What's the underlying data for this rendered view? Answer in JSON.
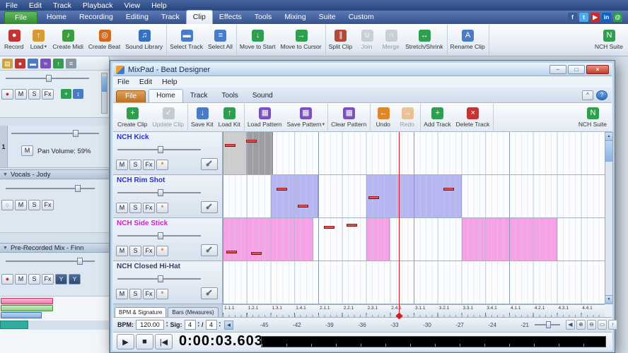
{
  "main": {
    "menubar": [
      "File",
      "Edit",
      "Track",
      "Playback",
      "View",
      "Help"
    ],
    "ribbon": {
      "file_tab": "File",
      "tabs": [
        {
          "label": "Home"
        },
        {
          "label": "Recording"
        },
        {
          "label": "Editing"
        },
        {
          "label": "Track"
        },
        {
          "label": "Clip",
          "active": true
        },
        {
          "label": "Effects"
        },
        {
          "label": "Tools"
        },
        {
          "label": "Mixing"
        },
        {
          "label": "Suite"
        },
        {
          "label": "Custom"
        }
      ],
      "social_icons": [
        {
          "name": "facebook",
          "glyph": "f",
          "color": "#3a5a98"
        },
        {
          "name": "twitter",
          "glyph": "t",
          "color": "#4aabee"
        },
        {
          "name": "youtube",
          "glyph": "▶",
          "color": "#cc2a2a"
        },
        {
          "name": "linkedin",
          "glyph": "in",
          "color": "#0a66c2"
        },
        {
          "name": "share",
          "glyph": "@",
          "color": "#2a9d48"
        }
      ]
    },
    "toolbar": {
      "groups": [
        {
          "buttons": [
            {
              "label": "Record",
              "icon": "●",
              "icon_bg": "#c13535"
            },
            {
              "label": "Load",
              "icon": "↑",
              "icon_bg": "#d79b33",
              "caret": "▾"
            },
            {
              "label": "Create Midi",
              "icon": "♪",
              "icon_bg": "#3f9b3f"
            },
            {
              "label": "Create Beat",
              "icon": "◎",
              "icon_bg": "#d2691e"
            },
            {
              "label": "Sound Library",
              "icon": "♫",
              "icon_bg": "#3a6fc0"
            }
          ]
        },
        {
          "buttons": [
            {
              "label": "Select Track",
              "icon": "▬",
              "icon_bg": "#4a7bc8"
            },
            {
              "label": "Select All",
              "icon": "≡",
              "icon_bg": "#4a7bc8"
            }
          ]
        },
        {
          "buttons": [
            {
              "label": "Move to Start",
              "icon": "↓",
              "icon_bg": "#2f9e4f"
            },
            {
              "label": "Move to Cursor",
              "icon": "→",
              "icon_bg": "#2f9e4f"
            }
          ]
        },
        {
          "buttons": [
            {
              "label": "Split Clip",
              "icon": "∥",
              "icon_bg": "#b5483a"
            },
            {
              "label": "Join",
              "icon": "∪",
              "icon_bg": "#9aa4ae",
              "disabled": true
            },
            {
              "label": "Merge",
              "icon": "∩",
              "icon_bg": "#9aa4ae",
              "disabled": true
            },
            {
              "label": "Stretch/Shrink",
              "icon": "↔",
              "icon_bg": "#2f9e4f"
            }
          ]
        },
        {
          "buttons": [
            {
              "label": "Rename Clip",
              "icon": "A",
              "icon_bg": "#4a7bc8"
            }
          ]
        },
        {
          "buttons": [
            {
              "label": "NCH Suite",
              "icon": "N",
              "icon_bg": "#2f9e4f"
            }
          ]
        }
      ]
    },
    "left_panel": {
      "tools": [
        {
          "name": "open-file",
          "glyph": "▤",
          "color": "#caa43e"
        },
        {
          "name": "record",
          "glyph": "●",
          "color": "#c13535"
        },
        {
          "name": "tracks",
          "glyph": "▬",
          "color": "#4a7bc8"
        },
        {
          "name": "effects",
          "glyph": "≈",
          "color": "#7a4fc0"
        },
        {
          "name": "upload",
          "glyph": "↑",
          "color": "#2f9e4f"
        },
        {
          "name": "menu",
          "glyph": "≡",
          "color": "#8a97a4"
        }
      ],
      "strip_icons": [
        {
          "name": "add-clip",
          "glyph": "+",
          "color": "#2f9e4f"
        },
        {
          "name": "move-vertical",
          "glyph": "↕",
          "color": "#4a7bc8"
        }
      ],
      "icons": {
        "record_dot": "●",
        "empty_dot": "○",
        "split": "Y",
        "collapse": "▼"
      },
      "track_number": "1",
      "pan_volume": "Pan Volume: 59%",
      "btn_m": "M",
      "btn_s": "S",
      "btn_fx": "Fx",
      "section1": "Vocals - Jody",
      "section2": "Pre-Recorded Mix - Finn"
    }
  },
  "dialog": {
    "title": "MixPad - Beat Designer",
    "window_buttons": {
      "minimize": "–",
      "maximize": "□",
      "close": "×"
    },
    "menu": [
      "File",
      "Edit",
      "Help"
    ],
    "ribbon": {
      "file_tab": "File",
      "tabs": [
        {
          "label": "Home",
          "active": true
        },
        {
          "label": "Track"
        },
        {
          "label": "Tools"
        },
        {
          "label": "Sound"
        }
      ],
      "collapse_glyph": "^",
      "help_glyph": "?"
    },
    "toolbar": {
      "groups": [
        {
          "buttons": [
            {
              "label": "Create Clip",
              "icon": "+",
              "icon_bg": "#2f9e4f"
            },
            {
              "label": "Update Clip",
              "icon": "✓",
              "icon_bg": "#8f9aa6",
              "disabled": true
            }
          ]
        },
        {
          "buttons": [
            {
              "label": "Save Kit",
              "icon": "↓",
              "icon_bg": "#4a7bc8"
            },
            {
              "label": "Load Kit",
              "icon": "↑",
              "icon_bg": "#2f9e4f"
            }
          ]
        },
        {
          "buttons": [
            {
              "label": "Load Pattern",
              "icon": "▦",
              "icon_bg": "#7a4fc0"
            },
            {
              "label": "Save Pattern",
              "icon": "▦",
              "icon_bg": "#7a4fc0",
              "caret": "▾"
            }
          ]
        },
        {
          "buttons": [
            {
              "label": "Clear Pattern",
              "icon": "▦",
              "icon_bg": "#7a4fc0"
            }
          ]
        },
        {
          "buttons": [
            {
              "label": "Undo",
              "icon": "←",
              "icon_bg": "#e0862a"
            },
            {
              "label": "Redo",
              "icon": "→",
              "icon_bg": "#e0862a",
              "disabled": true
            }
          ]
        },
        {
          "buttons": [
            {
              "label": "Add Track",
              "icon": "+",
              "icon_bg": "#2f9e4f"
            },
            {
              "label": "Delete Track",
              "icon": "×",
              "icon_bg": "#c13535"
            }
          ]
        },
        {
          "buttons": [
            {
              "label": "NCH Suite",
              "icon": "N",
              "icon_bg": "#2f9e4f"
            }
          ]
        }
      ]
    },
    "track_btns": {
      "m": "M",
      "s": "S",
      "fx": "Fx",
      "burst": "*"
    },
    "grid": {
      "beats_total": 16,
      "playhead_beat": 7.37,
      "tracks": [
        {
          "name": "NCH Kick",
          "name_color": "#2233cc",
          "cells": [
            {
              "start": 0,
              "len": 1,
              "color": "#cdcdcd"
            },
            {
              "start": 1,
              "len": 1.1,
              "color": "#9d9da2"
            }
          ],
          "markers": [
            {
              "beat": 0.15,
              "y": 28
            },
            {
              "beat": 1.05,
              "y": 18
            }
          ]
        },
        {
          "name": "NCH Rim Shot",
          "name_color": "#2233cc",
          "cells": [
            {
              "start": 2,
              "len": 2,
              "color": "#b6b6f2"
            },
            {
              "start": 6,
              "len": 4,
              "color": "#b6b6f2"
            }
          ],
          "markers": [
            {
              "beat": 2.3,
              "y": 30
            },
            {
              "beat": 3.2,
              "y": 70
            },
            {
              "beat": 6.15,
              "y": 50
            },
            {
              "beat": 9.3,
              "y": 30
            }
          ]
        },
        {
          "name": "NCH Side Stick",
          "name_color": "#cc22cc",
          "cells": [
            {
              "start": 0,
              "len": 3.8,
              "color": "#f6a2e6"
            },
            {
              "start": 6,
              "len": 1,
              "color": "#f6a2e6"
            },
            {
              "start": 10,
              "len": 4,
              "color": "#f6a2e6"
            }
          ],
          "markers": [
            {
              "beat": 0.2,
              "y": 76
            },
            {
              "beat": 1.25,
              "y": 80
            },
            {
              "beat": 4.3,
              "y": 18
            },
            {
              "beat": 5.25,
              "y": 14
            }
          ]
        },
        {
          "name": "NCH Closed Hi-Hat",
          "name_color": "#3c3c66",
          "cells": [],
          "markers": []
        }
      ]
    },
    "bottom_tabs": [
      {
        "label": "BPM & Signature",
        "active": true
      },
      {
        "label": "Bars (Measures)"
      }
    ],
    "ruler_labels": [
      "1.1.1",
      "1.2.1",
      "1.3.1",
      "1.4.1",
      "2.1.1",
      "2.2.1",
      "2.3.1",
      "2.4.1",
      "3.1.1",
      "3.2.1",
      "3.3.1",
      "3.4.1",
      "4.1.1",
      "4.2.1",
      "4.3.1",
      "4.4.1"
    ],
    "bpm": {
      "label": "BPM:",
      "value": "120.00",
      "sig_label": "Sig:",
      "sig_top": "4",
      "sig_sep": "/",
      "sig_bottom": "4"
    },
    "spin": {
      "up": "▴",
      "down": "▾"
    },
    "scroll": {
      "up": "▲",
      "down": "▼",
      "left": "◀"
    },
    "meter_scale": [
      "-45",
      "-42",
      "-39",
      "-36",
      "-33",
      "-30",
      "-27",
      "-24",
      "-21"
    ],
    "meter_icons": [
      {
        "name": "volume-icon",
        "glyph": "◀"
      },
      {
        "name": "zoom-in-icon",
        "glyph": "⊕"
      },
      {
        "name": "zoom-out-icon",
        "glyph": "⊖"
      },
      {
        "name": "zoom-fit-icon",
        "glyph": "▭"
      },
      {
        "name": "scroll-up-icon",
        "glyph": "↑"
      }
    ],
    "transport": {
      "play": "▶",
      "stop": "■",
      "to_start": "|◀",
      "time": "0:00:03.603"
    }
  }
}
